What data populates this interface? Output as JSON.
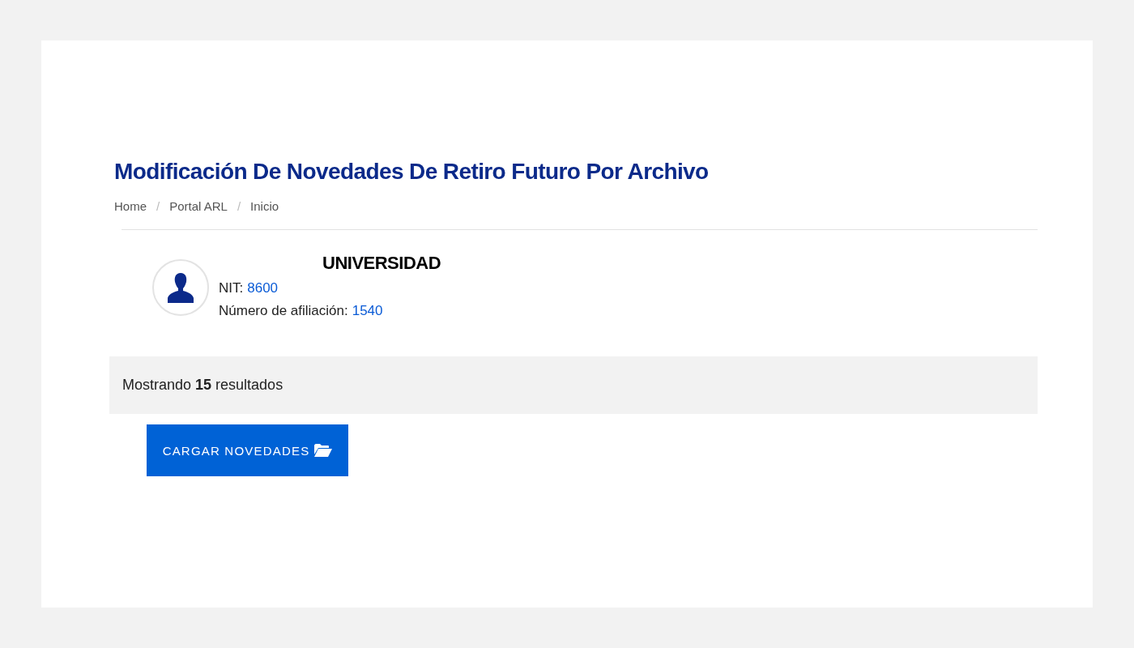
{
  "title": "Modificación De Novedades De Retiro Futuro Por Archivo",
  "breadcrumb": [
    {
      "label": "Home"
    },
    {
      "label": "Portal ARL"
    },
    {
      "label": "Inicio"
    }
  ],
  "separator": "/",
  "company": {
    "name": "UNIVERSIDAD",
    "nit_label": "NIT:",
    "nit": "8600",
    "affiliation_label": "Número de afiliación:",
    "affiliation": "1540"
  },
  "results": "Mostrando **15** resultados",
  "upload_button": "CARGAR NOVEDADES"
}
